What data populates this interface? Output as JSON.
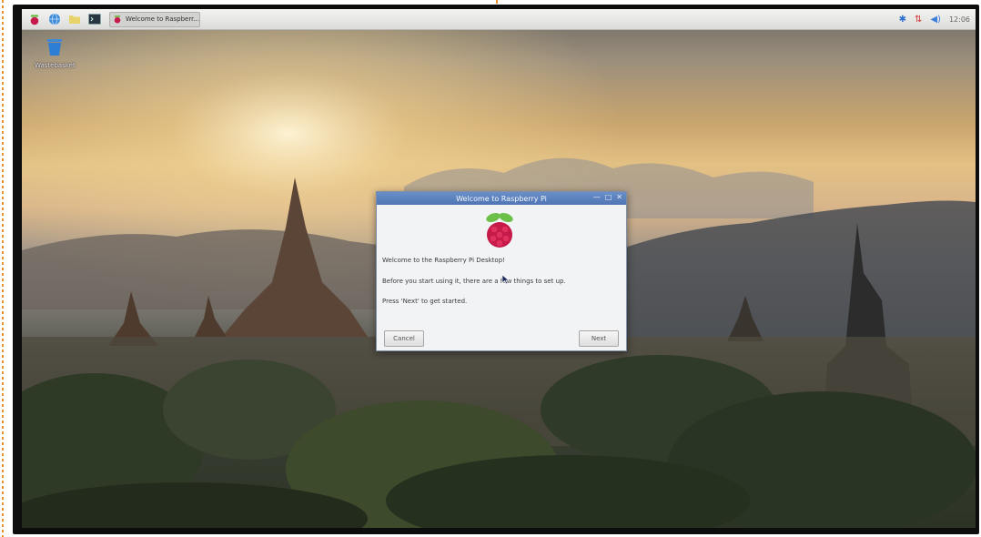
{
  "taskbar": {
    "launchers": [
      {
        "icon": "raspberry-menu-icon"
      },
      {
        "icon": "web-browser-icon"
      },
      {
        "icon": "file-manager-icon"
      },
      {
        "icon": "terminal-icon"
      }
    ],
    "task": {
      "label": "Welcome to Raspberr..."
    },
    "tray": {
      "clock": "12:06",
      "icons": [
        "bluetooth-icon",
        "network-icon",
        "volume-icon"
      ]
    }
  },
  "desktop": {
    "icons": [
      {
        "label": "Wastebasket",
        "icon": "wastebasket-icon"
      }
    ]
  },
  "dialog": {
    "title": "Welcome to Raspberry Pi",
    "controls": [
      "minimize-icon",
      "maximize-icon",
      "close-icon"
    ],
    "line1": "Welcome to the Raspberry Pi Desktop!",
    "line2": "Before you start using it, there are a few things to set up.",
    "line3": "Press 'Next' to get started.",
    "cancel_label": "Cancel",
    "next_label": "Next"
  },
  "colors": {
    "titlebar": "#5a80bd",
    "raspberry": "#c51a4a",
    "leaf": "#6cc04a"
  }
}
